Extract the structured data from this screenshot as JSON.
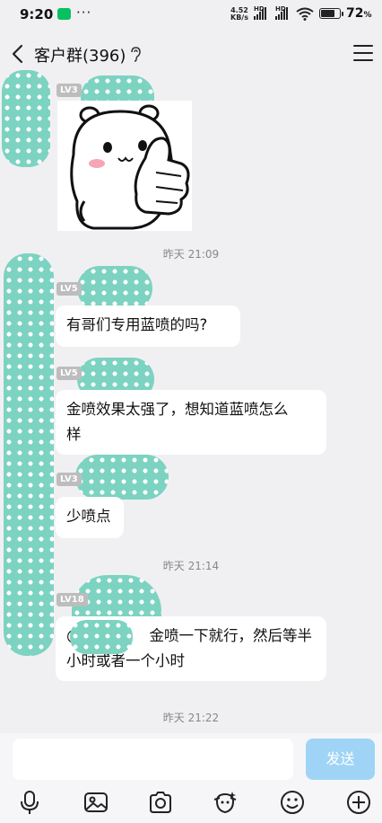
{
  "status_bar": {
    "time": "9:20",
    "speed_value": "4.52",
    "speed_unit": "KB/s",
    "hd1": "HD",
    "hd2": "HD",
    "battery": "72",
    "battery_unit": "%"
  },
  "header": {
    "title": "客户群(396)"
  },
  "messages": [
    {
      "level": "LV3",
      "type": "sticker"
    },
    {
      "timestamp": "昨天 21:09"
    },
    {
      "level": "LV5",
      "text": "有哥们专用蓝喷的吗?"
    },
    {
      "level": "LV5",
      "text_line1": "金喷效果太强了，想知道蓝喷怎么",
      "text_line2": "样"
    },
    {
      "level": "LV3",
      "text": "少喷点"
    },
    {
      "timestamp": "昨天 21:14"
    },
    {
      "level": "LV18",
      "mention_prefix": "@",
      "text_line1": "金喷一下就行，然后等半",
      "text_line2": "小时或者一个小时"
    },
    {
      "timestamp": "昨天 21:22"
    }
  ],
  "input": {
    "send_label": "发送"
  },
  "toolbar": {
    "icons": [
      "microphone-icon",
      "image-icon",
      "camera-icon",
      "sticker-face-icon",
      "emoji-icon",
      "plus-icon"
    ]
  },
  "colors": {
    "redaction": "#7dd3c1",
    "send_button": "#9fd4f6",
    "background": "#f0f0f2"
  }
}
